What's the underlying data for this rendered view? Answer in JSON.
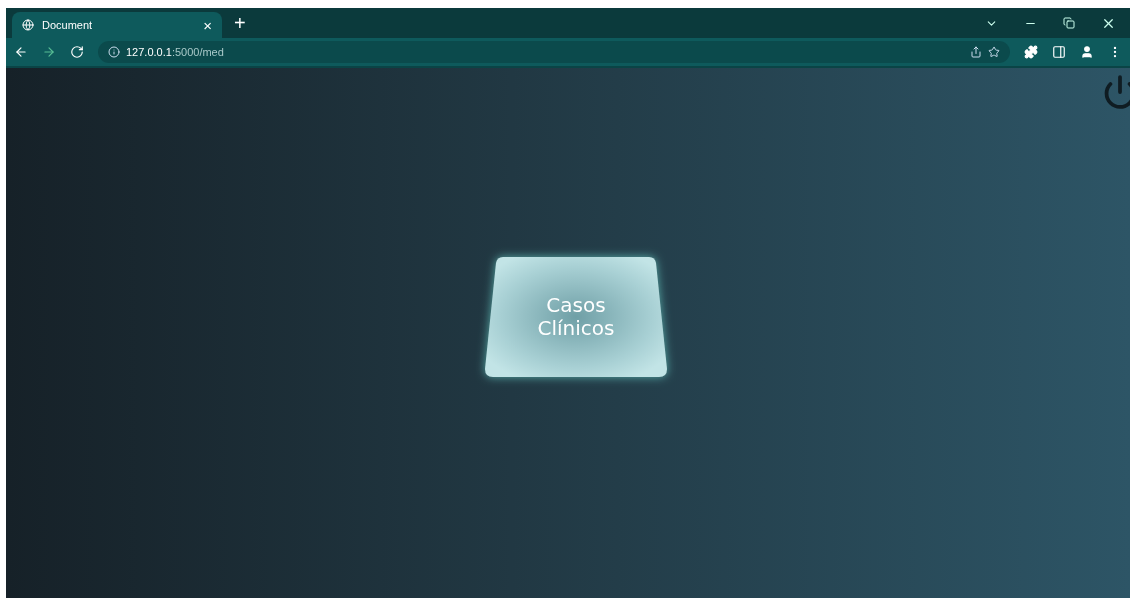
{
  "browser": {
    "tab": {
      "title": "Document",
      "selected": true
    },
    "close_glyph": "×",
    "new_tab_glyph": "+",
    "url_host": "127.0.0.1",
    "url_path": ":5000/med"
  },
  "page": {
    "card": {
      "line1": "Casos",
      "line2": "Clínicos"
    }
  }
}
